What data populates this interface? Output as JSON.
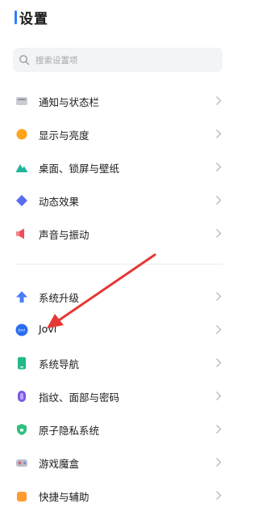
{
  "page": {
    "title": "设置"
  },
  "search": {
    "placeholder": "搜索设置项"
  },
  "groups": [
    {
      "items": [
        {
          "label": "通知与状态栏"
        },
        {
          "label": "显示与亮度"
        },
        {
          "label": "桌面、锁屏与壁纸"
        },
        {
          "label": "动态效果"
        },
        {
          "label": "声音与振动"
        }
      ]
    },
    {
      "items": [
        {
          "label": "系统升级"
        },
        {
          "label": "Jovi",
          "badge": "Jovi"
        },
        {
          "label": "系统导航"
        },
        {
          "label": "指纹、面部与密码"
        },
        {
          "label": "原子隐私系统"
        },
        {
          "label": "游戏魔盒"
        },
        {
          "label": "快捷与辅助"
        }
      ]
    }
  ],
  "colors": {
    "accent": "#2f7dff",
    "annotation_arrow": "#e53935"
  }
}
